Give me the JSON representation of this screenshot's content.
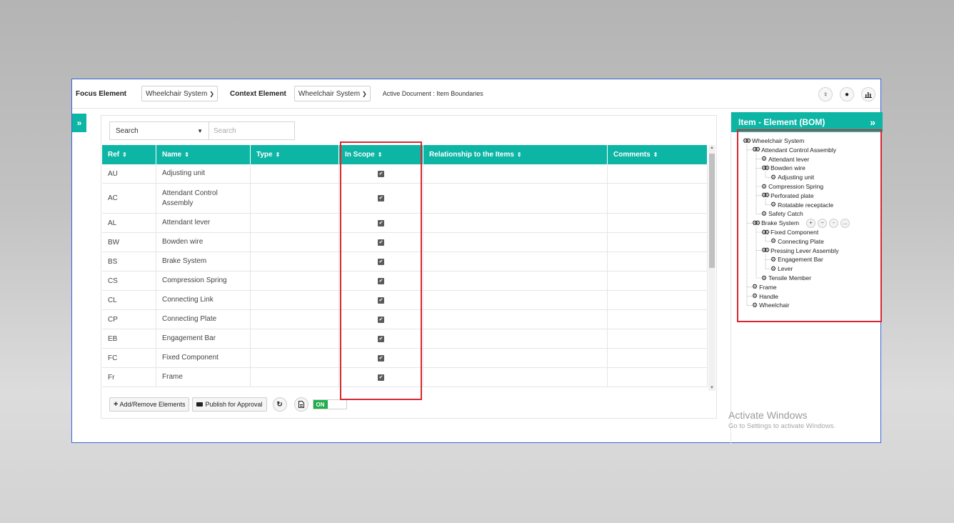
{
  "topbar": {
    "focus_label": "Focus Element",
    "focus_value": "Wheelchair System",
    "context_label": "Context Element",
    "context_value": "Wheelchair System",
    "active_document": "Active Document : Item Boundaries",
    "icons": [
      "venus-icon",
      "drop-icon",
      "bar-chart-icon"
    ]
  },
  "search": {
    "select_value": "Search",
    "placeholder": "Search"
  },
  "table": {
    "columns": [
      "Ref",
      "Name",
      "Type",
      "In Scope",
      "Relationship to the Items",
      "Comments"
    ],
    "rows": [
      {
        "ref": "AU",
        "name": "Adjusting unit",
        "type": "",
        "in_scope": true,
        "relationship": "",
        "comments": ""
      },
      {
        "ref": "AC",
        "name": "Attendant Control Assembly",
        "type": "",
        "in_scope": true,
        "relationship": "",
        "comments": ""
      },
      {
        "ref": "AL",
        "name": "Attendant lever",
        "type": "",
        "in_scope": true,
        "relationship": "",
        "comments": ""
      },
      {
        "ref": "BW",
        "name": "Bowden wire",
        "type": "",
        "in_scope": true,
        "relationship": "",
        "comments": ""
      },
      {
        "ref": "BS",
        "name": "Brake System",
        "type": "",
        "in_scope": true,
        "relationship": "",
        "comments": ""
      },
      {
        "ref": "CS",
        "name": "Compression Spring",
        "type": "",
        "in_scope": true,
        "relationship": "",
        "comments": ""
      },
      {
        "ref": "CL",
        "name": "Connecting Link",
        "type": "",
        "in_scope": true,
        "relationship": "",
        "comments": ""
      },
      {
        "ref": "CP",
        "name": "Connecting Plate",
        "type": "",
        "in_scope": true,
        "relationship": "",
        "comments": ""
      },
      {
        "ref": "EB",
        "name": "Engagement Bar",
        "type": "",
        "in_scope": true,
        "relationship": "",
        "comments": ""
      },
      {
        "ref": "FC",
        "name": "Fixed Component",
        "type": "",
        "in_scope": true,
        "relationship": "",
        "comments": ""
      },
      {
        "ref": "Fr",
        "name": "Frame",
        "type": "",
        "in_scope": true,
        "relationship": "",
        "comments": ""
      }
    ]
  },
  "toolbar": {
    "add_remove_label": "Add/Remove Elements",
    "publish_label": "Publish for Approval",
    "toggle_label": "ON"
  },
  "sidebar": {
    "title": "Item - Element (BOM)",
    "tree": [
      {
        "label": "Wheelchair System",
        "depth": 0,
        "icon": "gears-icon"
      },
      {
        "label": "Attendant Control Assembly",
        "depth": 1,
        "icon": "gears-icon"
      },
      {
        "label": "Attendant lever",
        "depth": 2,
        "icon": "gear-icon"
      },
      {
        "label": "Bowden wire",
        "depth": 2,
        "icon": "gears-icon"
      },
      {
        "label": "Adjusting unit",
        "depth": 3,
        "icon": "gear-icon"
      },
      {
        "label": "Compression Spring",
        "depth": 2,
        "icon": "gear-icon"
      },
      {
        "label": "Perforated plate",
        "depth": 2,
        "icon": "gears-icon"
      },
      {
        "label": "Rotatable receptacle",
        "depth": 3,
        "icon": "gear-icon"
      },
      {
        "label": "Safety Catch",
        "depth": 2,
        "icon": "gear-icon"
      },
      {
        "label": "Brake System",
        "depth": 1,
        "icon": "gears-icon"
      },
      {
        "label": "Fixed Component",
        "depth": 2,
        "icon": "gears-icon"
      },
      {
        "label": "Connecting Plate",
        "depth": 3,
        "icon": "gear-icon"
      },
      {
        "label": "Pressing Lever Assembly",
        "depth": 2,
        "icon": "gears-icon"
      },
      {
        "label": "Engagement Bar",
        "depth": 3,
        "icon": "gear-icon"
      },
      {
        "label": "Lever",
        "depth": 3,
        "icon": "gear-icon"
      },
      {
        "label": "Tensile Member",
        "depth": 2,
        "icon": "gear-icon"
      },
      {
        "label": "Frame",
        "depth": 1,
        "icon": "gear-icon"
      },
      {
        "label": "Handle",
        "depth": 1,
        "icon": "gear-icon"
      },
      {
        "label": "Wheelchair",
        "depth": 1,
        "icon": "gear-icon"
      }
    ]
  },
  "watermark": {
    "line1": "Activate Windows",
    "line2": "Go to Settings to activate Windows."
  },
  "colors": {
    "accent": "#0db5a5",
    "highlight": "#d8272f",
    "toggle_on": "#1fae4b"
  }
}
